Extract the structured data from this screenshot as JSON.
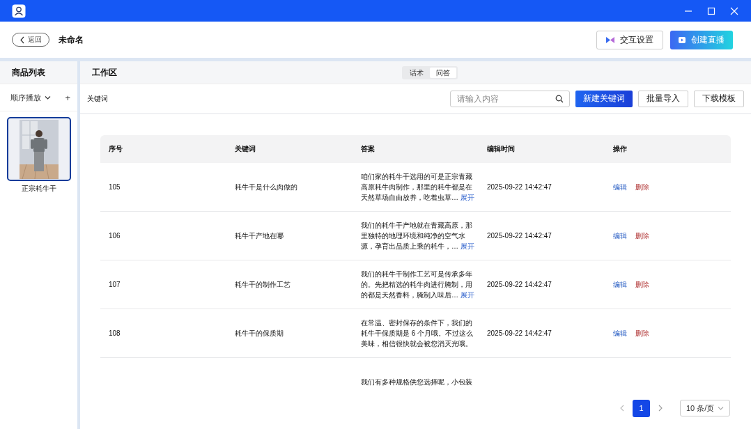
{
  "header": {
    "back_button": "返回",
    "title": "未命名",
    "buttons": [
      {
        "label": "交互设置",
        "kind": "outline"
      },
      {
        "label": "创建直播",
        "kind": "primary"
      }
    ]
  },
  "sidebar": {
    "title": "商品列表",
    "play_mode": "顺序播放",
    "add": "+",
    "items": [
      {
        "kind": "picture",
        "label": "正宗耗牛干",
        "selected": true
      }
    ]
  },
  "workspace": {
    "title": "工作区",
    "tabs": [
      {
        "label": "话术",
        "selected": false
      },
      {
        "label": "问答",
        "selected": true
      }
    ],
    "toolbar": {
      "label": "关键词",
      "search": {
        "placeholder": "请输入内容"
      },
      "buttons": [
        {
          "label": "新建关键词",
          "kind": "primary"
        },
        {
          "label": "批量导入",
          "kind": "outline"
        },
        {
          "label": "下载模板",
          "kind": "outline"
        }
      ]
    },
    "table": {
      "columns": [
        "序号",
        "关键词",
        "答案",
        "编辑时间",
        "操作"
      ],
      "rows": [
        {
          "id": "105",
          "keyword": "耗牛干是什么肉做的",
          "answer": "咱们家的耗牛干选用的可是正宗青藏高原耗牛肉制作，那里的耗牛都是在天然草场自由放养，吃着虫草…",
          "expand": "展开",
          "time": "2025-09-22 14:42:47",
          "actions": [
            "编辑",
            "删除"
          ]
        },
        {
          "id": "106",
          "keyword": "耗牛干产地在哪",
          "answer": "我们的耗牛干产地就在青藏高原，那里独特的地理环境和纯净的空气水源，孕育出品质上乘的耗牛，…",
          "expand": "展开",
          "time": "2025-09-22 14:42:47",
          "actions": [
            "编辑",
            "删除"
          ]
        },
        {
          "id": "107",
          "keyword": "耗牛干的制作工艺",
          "answer": "我们的耗牛干制作工艺可是传承多年的。先把精选的耗牛肉进行腌制，用的都是天然香料，腌制入味后…",
          "expand": "展开",
          "time": "2025-09-22 14:42:47",
          "actions": [
            "编辑",
            "删除"
          ]
        },
        {
          "id": "108",
          "keyword": "耗牛干的保质期",
          "answer": "在常温、密封保存的条件下，我们的耗牛干保质期是 6 个月哦。不过这么美味，相信很快就会被您消灭光哦。",
          "time": "2025-09-22 14:42:47",
          "actions": [
            "编辑",
            "删除"
          ]
        },
        {
          "answer": "我们有多种规格供您选择呢，小包装"
        }
      ]
    },
    "pagination": {
      "pages": [
        {
          "label": "1",
          "selected": true
        }
      ],
      "page_size": "10 条/页"
    }
  }
}
